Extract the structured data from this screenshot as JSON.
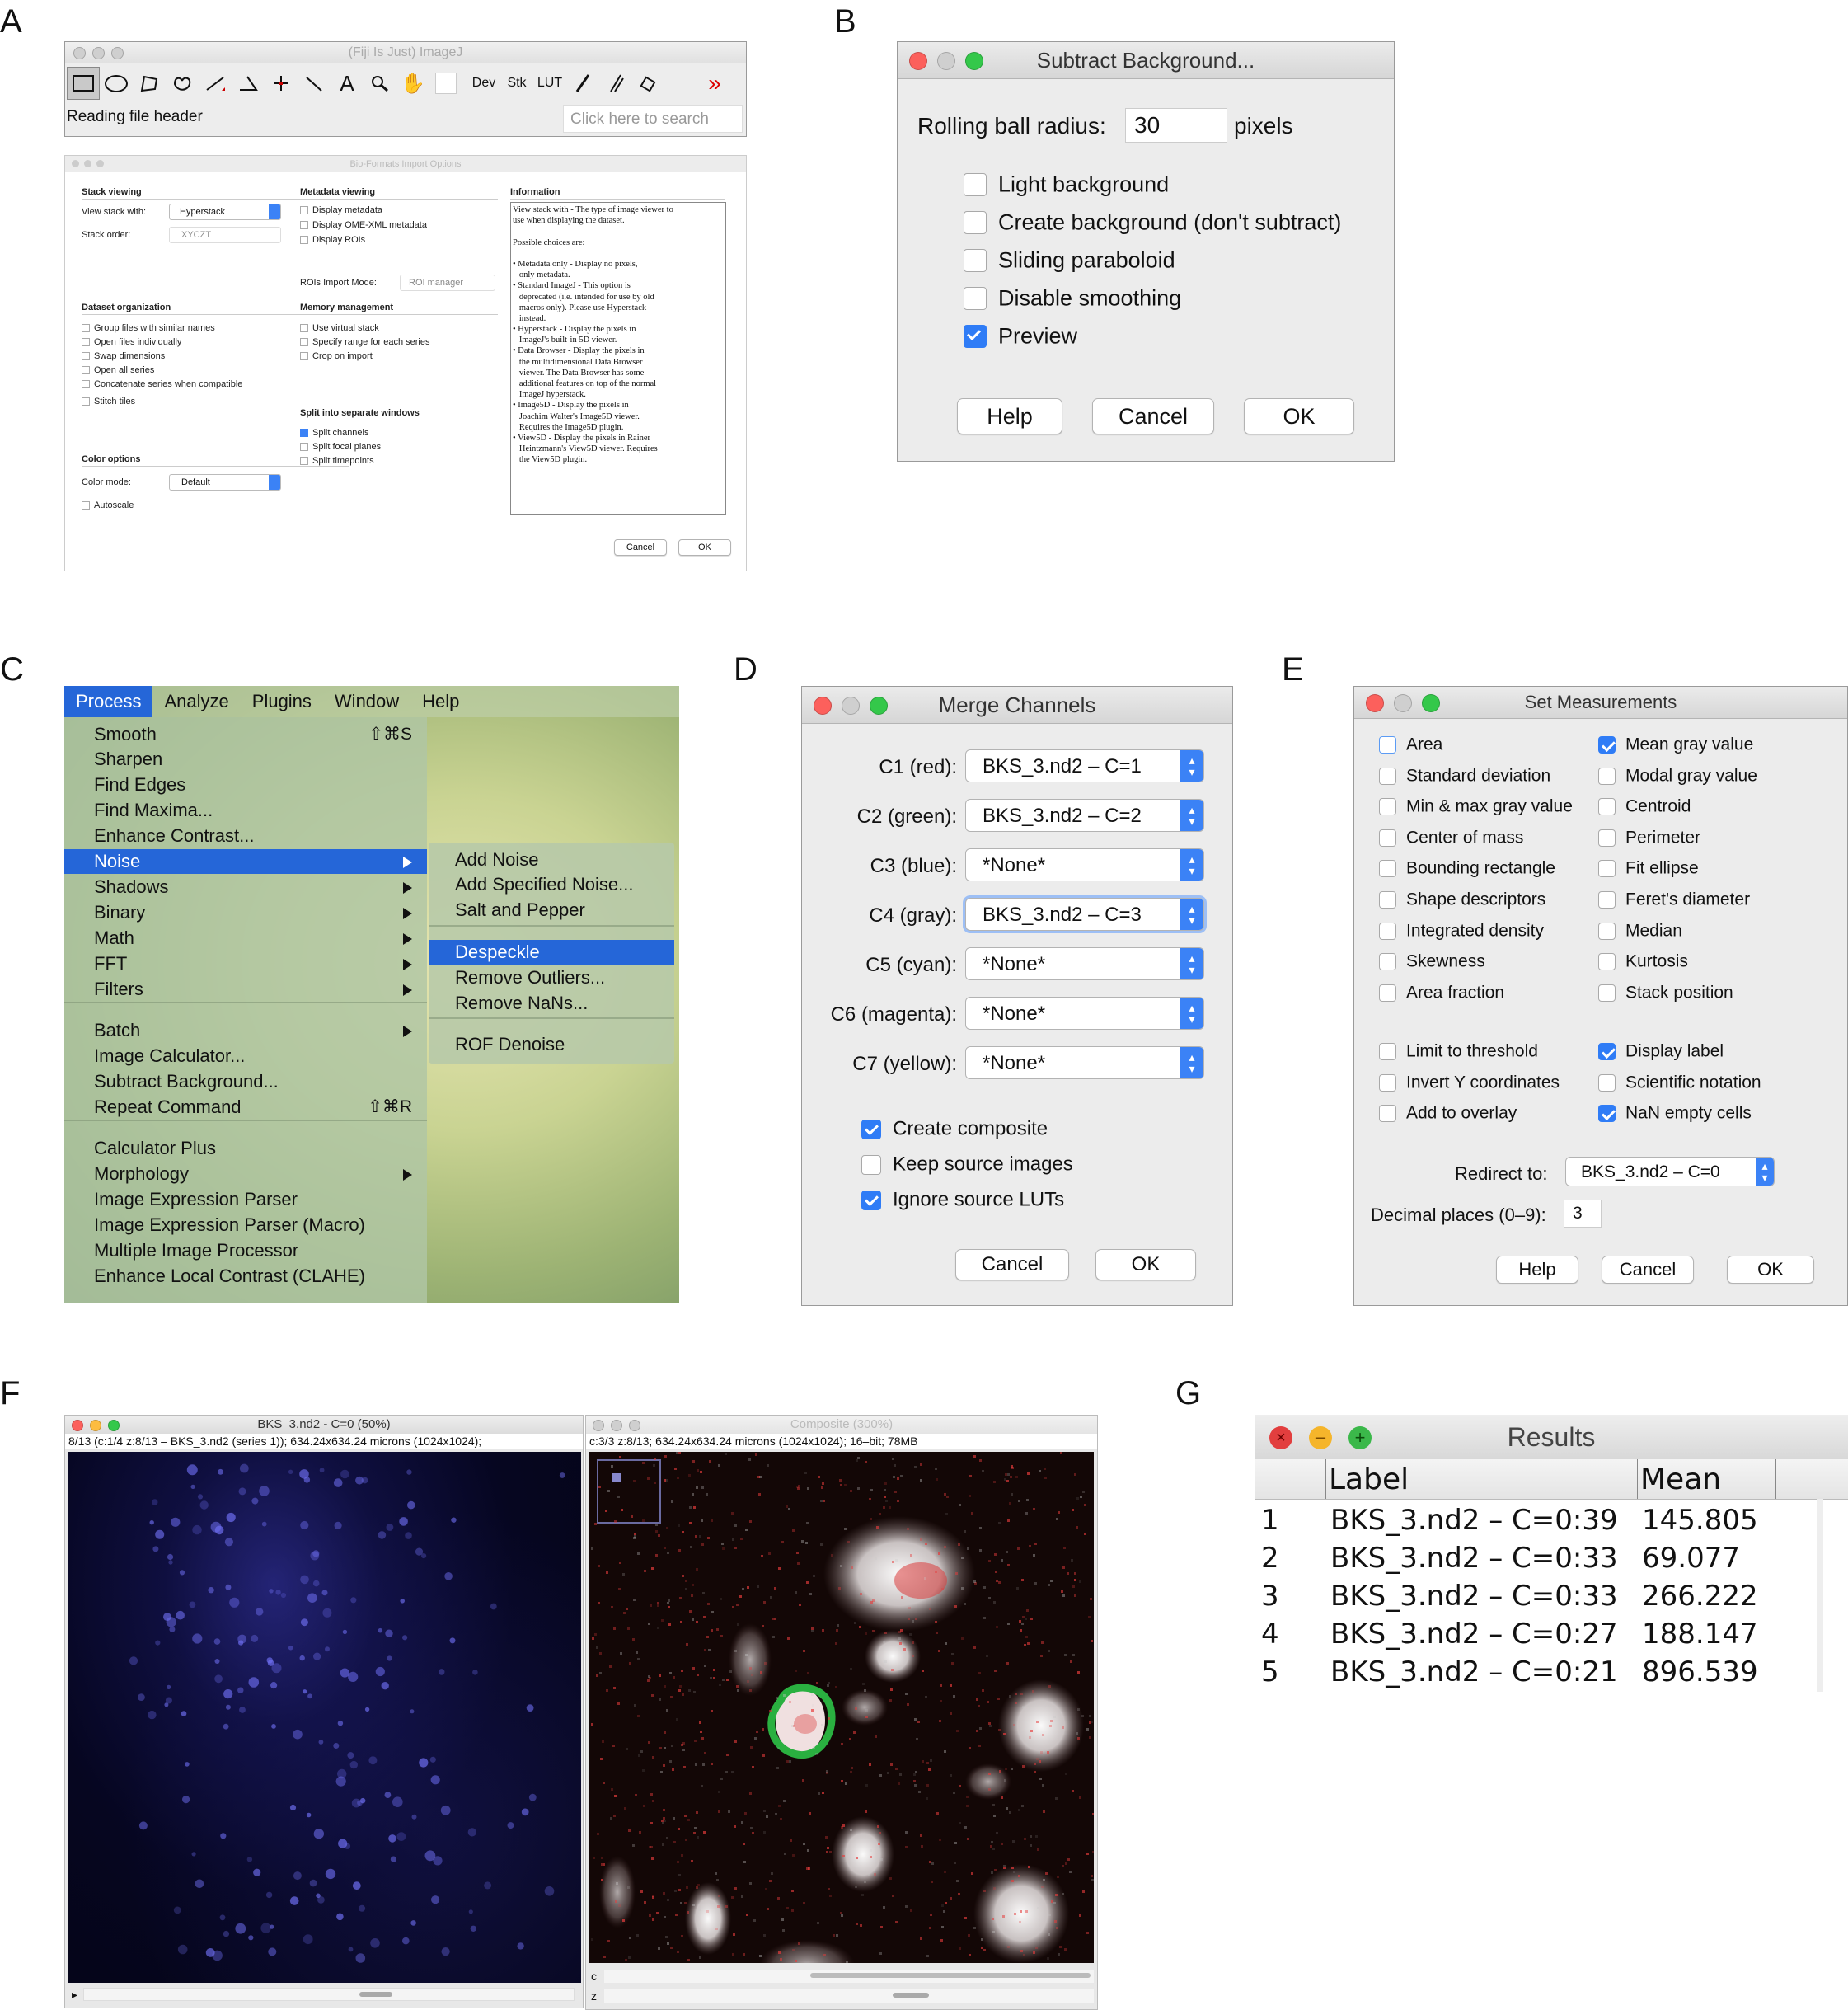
{
  "panel_letters": [
    "A",
    "B",
    "C",
    "D",
    "E",
    "F",
    "G"
  ],
  "panelA": {
    "imagej": {
      "title": "(Fiji Is Just) ImageJ",
      "tools_right": [
        "Dev",
        "Stk",
        "LUT"
      ],
      "more": "»",
      "status": "Reading file header",
      "search_placeholder": "Click here to search"
    },
    "bioformats": {
      "title": "Bio-Formats Import Options",
      "stack_viewing": "Stack viewing",
      "view_stack_with_label": "View stack with:",
      "view_stack_with_value": "Hyperstack",
      "stack_order_label": "Stack order:",
      "stack_order_value": "XYCZT",
      "dataset_org": "Dataset organization",
      "dataset_items": [
        "Group files with similar names",
        "Open files individually",
        "Swap dimensions",
        "Open all series",
        "Concatenate series when compatible",
        "Stitch tiles"
      ],
      "color_options": "Color options",
      "color_mode_label": "Color mode:",
      "color_mode_value": "Default",
      "autoscale": "Autoscale",
      "metadata_viewing": "Metadata viewing",
      "metadata_items": [
        "Display metadata",
        "Display OME-XML metadata",
        "Display ROIs"
      ],
      "rois_mode_label": "ROIs Import Mode:",
      "rois_mode_value": "ROI manager",
      "memory": "Memory management",
      "memory_items": [
        "Use virtual stack",
        "Specify range for each series",
        "Crop on import"
      ],
      "split": "Split into separate windows",
      "split_items": [
        "Split channels",
        "Split focal planes",
        "Split timepoints"
      ],
      "information": "Information",
      "info_lines": [
        "View stack with - The type of image viewer to",
        "use when displaying the dataset.",
        "",
        "Possible choices are:",
        "",
        "• Metadata only - Display no pixels,",
        "   only metadata.",
        "• Standard ImageJ - This option is",
        "   deprecated (i.e. intended for use by old",
        "   macros only). Please use Hyperstack",
        "   instead.",
        "• Hyperstack - Display the pixels in",
        "   ImageJ's built-in 5D viewer.",
        "• Data Browser - Display the pixels in",
        "   the multidimensional Data Browser",
        "   viewer. The Data Browser has some",
        "   additional features on top of the normal",
        "   ImageJ hyperstack.",
        "• Image5D - Display the pixels in",
        "   Joachim Walter's Image5D viewer.",
        "   Requires the Image5D plugin.",
        "• View5D - Display the pixels in Rainer",
        "   Heintzmann's View5D viewer. Requires",
        "   the View5D plugin."
      ],
      "cancel": "Cancel",
      "ok": "OK"
    }
  },
  "panelB": {
    "title": "Subtract Background...",
    "radius_label": "Rolling ball radius:",
    "radius_value": "30",
    "radius_unit": "pixels",
    "options": [
      {
        "label": "Light background",
        "checked": false
      },
      {
        "label": "Create background (don't subtract)",
        "checked": false
      },
      {
        "label": "Sliding paraboloid",
        "checked": false
      },
      {
        "label": "Disable smoothing",
        "checked": false
      },
      {
        "label": "Preview",
        "checked": true
      }
    ],
    "help": "Help",
    "cancel": "Cancel",
    "ok": "OK"
  },
  "panelC": {
    "menubar": [
      "Process",
      "Analyze",
      "Plugins",
      "Window",
      "Help"
    ],
    "menu_items": [
      {
        "label": "Smooth",
        "shortcut": "⇧⌘S",
        "sub": false
      },
      {
        "label": "Sharpen",
        "shortcut": "",
        "sub": false
      },
      {
        "label": "Find Edges",
        "shortcut": "",
        "sub": false
      },
      {
        "label": "Find Maxima...",
        "shortcut": "",
        "sub": false
      },
      {
        "label": "Enhance Contrast...",
        "shortcut": "",
        "sub": false
      },
      {
        "label": "Noise",
        "shortcut": "",
        "sub": true
      },
      {
        "label": "Shadows",
        "shortcut": "",
        "sub": true
      },
      {
        "label": "Binary",
        "shortcut": "",
        "sub": true
      },
      {
        "label": "Math",
        "shortcut": "",
        "sub": true
      },
      {
        "label": "FFT",
        "shortcut": "",
        "sub": true
      },
      {
        "label": "Filters",
        "shortcut": "",
        "sub": true
      },
      {
        "label": "Batch",
        "shortcut": "",
        "sub": true
      },
      {
        "label": "Image Calculator...",
        "shortcut": "",
        "sub": false
      },
      {
        "label": "Subtract Background...",
        "shortcut": "",
        "sub": false
      },
      {
        "label": "Repeat Command",
        "shortcut": "⇧⌘R",
        "sub": false
      },
      {
        "label": "Calculator Plus",
        "shortcut": "",
        "sub": false
      },
      {
        "label": "Morphology",
        "shortcut": "",
        "sub": true
      },
      {
        "label": "Image Expression Parser",
        "shortcut": "",
        "sub": false
      },
      {
        "label": "Image Expression Parser (Macro)",
        "shortcut": "",
        "sub": false
      },
      {
        "label": "Multiple Image Processor",
        "shortcut": "",
        "sub": false
      },
      {
        "label": "Enhance Local Contrast (CLAHE)",
        "shortcut": "",
        "sub": false
      }
    ],
    "submenu_items": [
      "Add Noise",
      "Add Specified Noise...",
      "Salt and Pepper",
      "Despeckle",
      "Remove Outliers...",
      "Remove NaNs...",
      "ROF Denoise"
    ]
  },
  "panelD": {
    "title": "Merge Channels",
    "channels": [
      {
        "label": "C1 (red):",
        "value": "BKS_3.nd2 – C=1"
      },
      {
        "label": "C2 (green):",
        "value": "BKS_3.nd2 – C=2"
      },
      {
        "label": "C3 (blue):",
        "value": "*None*"
      },
      {
        "label": "C4 (gray):",
        "value": "BKS_3.nd2 – C=3"
      },
      {
        "label": "C5 (cyan):",
        "value": "*None*"
      },
      {
        "label": "C6 (magenta):",
        "value": "*None*"
      },
      {
        "label": "C7 (yellow):",
        "value": "*None*"
      }
    ],
    "options": [
      {
        "label": "Create composite",
        "checked": true
      },
      {
        "label": "Keep source images",
        "checked": false
      },
      {
        "label": "Ignore source LUTs",
        "checked": true
      }
    ],
    "cancel": "Cancel",
    "ok": "OK"
  },
  "panelE": {
    "title": "Set Measurements",
    "left": [
      {
        "label": "Area",
        "checked": false
      },
      {
        "label": "Standard deviation",
        "checked": false
      },
      {
        "label": "Min & max gray value",
        "checked": false
      },
      {
        "label": "Center of mass",
        "checked": false
      },
      {
        "label": "Bounding rectangle",
        "checked": false
      },
      {
        "label": "Shape descriptors",
        "checked": false
      },
      {
        "label": "Integrated density",
        "checked": false
      },
      {
        "label": "Skewness",
        "checked": false
      },
      {
        "label": "Area fraction",
        "checked": false
      }
    ],
    "right": [
      {
        "label": "Mean gray value",
        "checked": true
      },
      {
        "label": "Modal gray value",
        "checked": false
      },
      {
        "label": "Centroid",
        "checked": false
      },
      {
        "label": "Perimeter",
        "checked": false
      },
      {
        "label": "Fit ellipse",
        "checked": false
      },
      {
        "label": "Feret's diameter",
        "checked": false
      },
      {
        "label": "Median",
        "checked": false
      },
      {
        "label": "Kurtosis",
        "checked": false
      },
      {
        "label": "Stack position",
        "checked": false
      }
    ],
    "left2": [
      {
        "label": "Limit to threshold",
        "checked": false
      },
      {
        "label": "Invert Y coordinates",
        "checked": false
      },
      {
        "label": "Add to overlay",
        "checked": false
      }
    ],
    "right2": [
      {
        "label": "Display label",
        "checked": true
      },
      {
        "label": "Scientific notation",
        "checked": false
      },
      {
        "label": "NaN empty cells",
        "checked": true
      }
    ],
    "redirect_label": "Redirect to:",
    "redirect_value": "BKS_3.nd2 – C=0",
    "decimal_label": "Decimal places (0–9):",
    "decimal_value": "3",
    "help": "Help",
    "cancel": "Cancel",
    "ok": "OK"
  },
  "panelF": {
    "left_title": "BKS_3.nd2 - C=0 (50%)",
    "left_info": "8/13 (c:1/4 z:8/13 – BKS_3.nd2 (series 1)); 634.24x634.24 microns (1024x1024);",
    "right_title": "Composite (300%)",
    "right_info": "c:3/3 z:8/13; 634.24x634.24 microns (1024x1024); 16–bit; 78MB",
    "c_label": "c",
    "z_label": "z",
    "play": "▸"
  },
  "panelG": {
    "title": "Results",
    "headers": [
      "Label",
      "Mean"
    ],
    "rows": [
      {
        "n": "1",
        "label": "BKS_3.nd2 – C=0:39",
        "mean": "145.805"
      },
      {
        "n": "2",
        "label": "BKS_3.nd2 – C=0:33",
        "mean": "69.077"
      },
      {
        "n": "3",
        "label": "BKS_3.nd2 – C=0:33",
        "mean": "266.222"
      },
      {
        "n": "4",
        "label": "BKS_3.nd2 – C=0:27",
        "mean": "188.147"
      },
      {
        "n": "5",
        "label": "BKS_3.nd2 – C=0:21",
        "mean": "896.539"
      }
    ]
  }
}
